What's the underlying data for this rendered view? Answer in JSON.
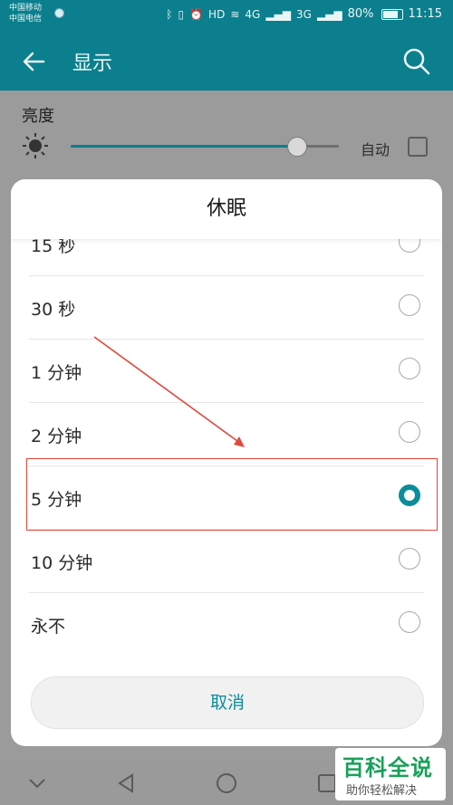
{
  "status_bar": {
    "carrier_1": "中国移动",
    "carrier_2": "中国电信",
    "network_4g": "4G",
    "network_3g": "3G",
    "hd": "HD",
    "battery": "80%",
    "battery_level": 0.8,
    "time": "11:15"
  },
  "app_bar": {
    "title": "显示",
    "back_icon": "arrow-left-icon",
    "search_icon": "search-icon"
  },
  "brightness": {
    "label": "亮度",
    "level": 0.84,
    "auto_label": "自动",
    "auto_checked": false
  },
  "sleep_dialog": {
    "title": "休眠",
    "options": [
      {
        "label": "15 秒",
        "selected": false
      },
      {
        "label": "30 秒",
        "selected": false
      },
      {
        "label": "1 分钟",
        "selected": false
      },
      {
        "label": "2 分钟",
        "selected": false
      },
      {
        "label": "5 分钟",
        "selected": true
      },
      {
        "label": "10 分钟",
        "selected": false
      },
      {
        "label": "永不",
        "selected": false
      }
    ],
    "cancel_label": "取消"
  },
  "colors": {
    "accent": "#0b8d9b",
    "app_bar": "#0b7f8d",
    "annotation": "#e04a3c"
  },
  "watermark": {
    "main": "百科全说",
    "sub": "助你轻松解决"
  }
}
